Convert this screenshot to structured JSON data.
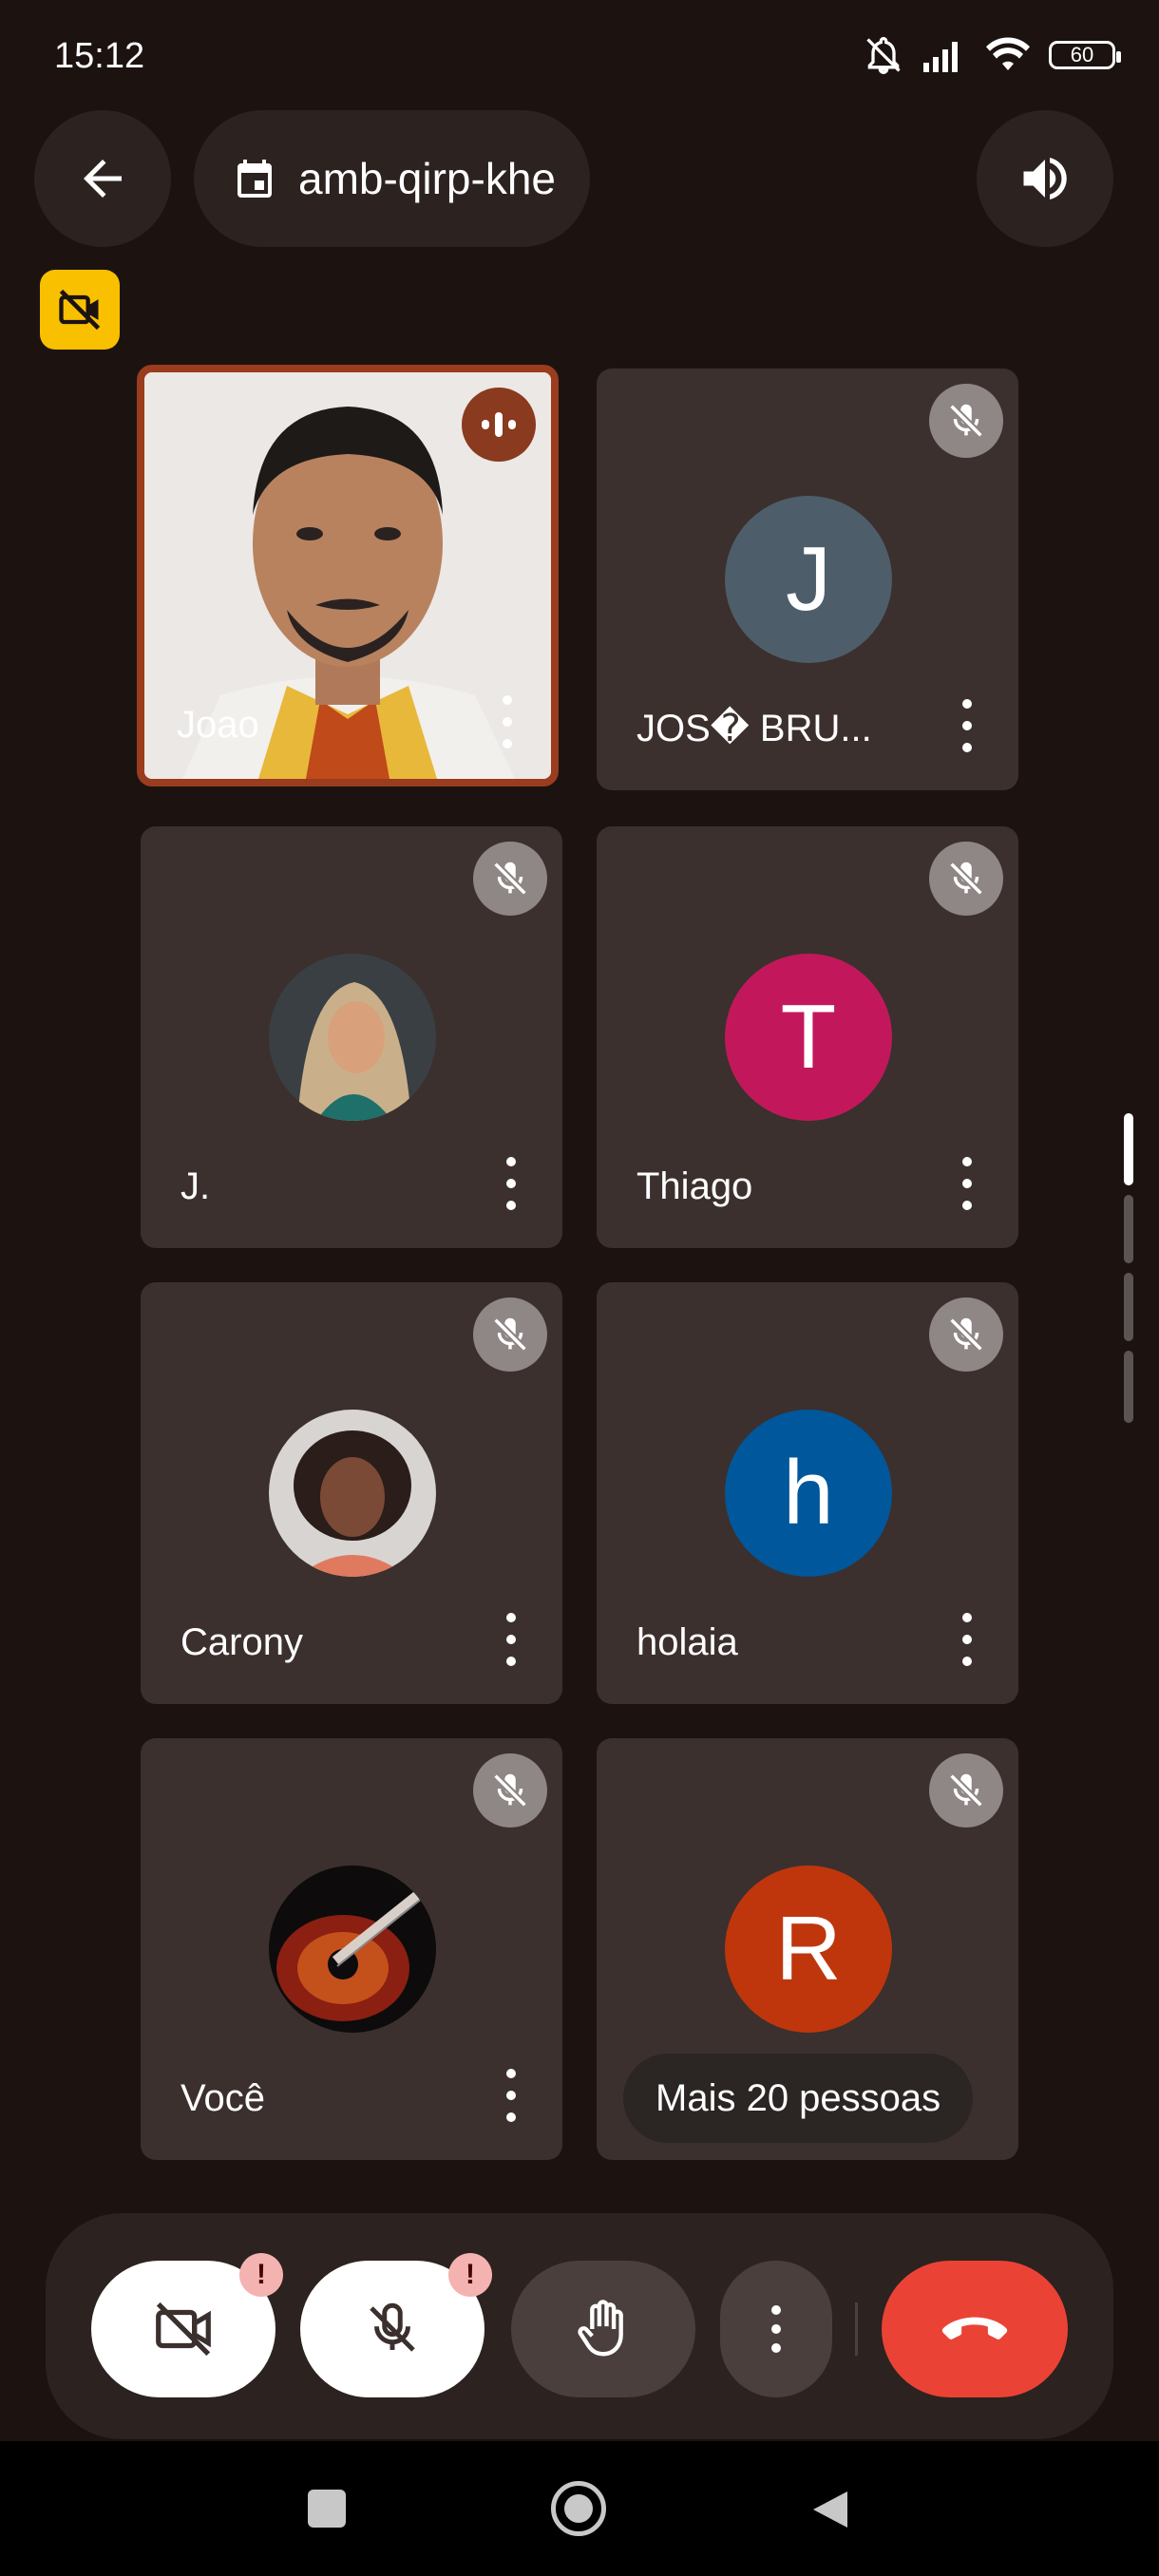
{
  "status": {
    "time": "15:12",
    "battery": "60"
  },
  "meeting": {
    "code": "amb-qirp-khe"
  },
  "participants": [
    {
      "name": "Joao",
      "speaking": true
    },
    {
      "name": "JOS� BRU...",
      "initial": "J",
      "color": "#4e5d6a"
    },
    {
      "name": "J."
    },
    {
      "name": "Thiago",
      "initial": "T",
      "color": "#c2185b"
    },
    {
      "name": "Carony"
    },
    {
      "name": "holaia",
      "initial": "h",
      "color": "#01579b"
    },
    {
      "name": "Você"
    },
    {
      "name": "R",
      "initial": "R",
      "color": "#bf360c"
    }
  ],
  "more_people": "Mais 20 pessoas",
  "colors": {
    "background": "#1c1311",
    "end_call": "#ea4335",
    "tile": "#3b302d",
    "speaking_border": "#9a3c1e"
  }
}
